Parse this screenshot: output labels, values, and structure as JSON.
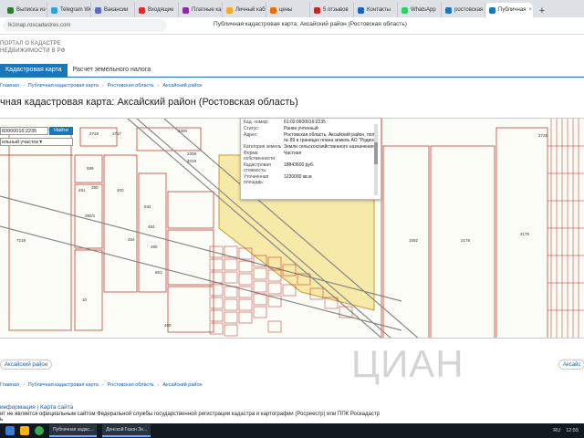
{
  "browser": {
    "tabs": [
      {
        "label": "Выписка из Е",
        "color": "#2e7d32",
        "active": false
      },
      {
        "label": "Telegram Web",
        "color": "#2aa3e0",
        "active": false
      },
      {
        "label": "Вакансии",
        "color": "#5c6bc0",
        "active": false
      },
      {
        "label": "Входящие",
        "color": "#d93025",
        "active": false
      },
      {
        "label": "Платные карт",
        "color": "#8e24aa",
        "active": false
      },
      {
        "label": "Личный каби",
        "color": "#f9a825",
        "active": false
      },
      {
        "label": "цены",
        "color": "#ef6c00",
        "active": false
      },
      {
        "label": "5 отзывов",
        "color": "#c62828",
        "active": false
      },
      {
        "label": "Контакты",
        "color": "#1565c0",
        "active": false
      },
      {
        "label": "WhatsApp",
        "color": "#25d366",
        "active": false
      },
      {
        "label": "ростовская",
        "color": "#1976b8",
        "active": false
      },
      {
        "label": "Публичная",
        "color": "#1976b8",
        "active": true
      }
    ],
    "url": "lk1map.roscadastres.com",
    "window_title": "Публичная кадастровая карта: Аксайский район (Ростовская область)"
  },
  "site": {
    "portal_line1": "ПОРТАЛ О КАДАСТРЕ",
    "portal_line2": "НЕДВИЖИМОСТИ В РФ",
    "nav": {
      "tab1": "Кадастровая карта",
      "tab2": "Расчет земельного налога"
    },
    "breadcrumbs_top": [
      "Главная",
      "Публичная кадастровая карта",
      "Ростовская область",
      "Аксайский район"
    ],
    "page_title": "чная кадастровая карта: Аксайский район (Ростовская область)"
  },
  "search": {
    "value": "60000016:2235",
    "button": "Найти",
    "select": "ельный участок"
  },
  "info": {
    "rows": [
      {
        "k": "Кад. номер:",
        "v": "61:02:0600016:2235"
      },
      {
        "k": "Статус:",
        "v": "Ранее учтенный"
      },
      {
        "k": "Адрес:",
        "v": "Ростовская область, Аксайский район, поле № 89 в границах плана земель АО \"Родина\""
      },
      {
        "k": "Категория земель:",
        "v": "Земли сельскохозяйственного назначения"
      },
      {
        "k": "Форма собственности:",
        "v": "Частная"
      },
      {
        "k": "Кадастровая стоимость:",
        "v": "18843600 руб."
      },
      {
        "k": "Уточненная площадь:",
        "v": "1230000 кв.м"
      }
    ]
  },
  "map_labels": [
    "2718",
    "2306",
    "2717",
    "599",
    "491",
    "390",
    "390/1",
    "7219",
    "10",
    "400",
    "842",
    "484",
    "464",
    "460",
    "861",
    "490",
    "1592",
    "2178",
    "2176",
    "2725",
    "2308",
    "4019"
  ],
  "below_map": {
    "left_pill": "Аксайский район",
    "right_pill": "Аксайс",
    "breadcrumbs": [
      "Главная",
      "Публичная кадастровая карта",
      "Ростовская область",
      "Аксайский район"
    ]
  },
  "watermark": "ЦИАН",
  "footer": {
    "links": "информация | Карта сайта",
    "note": "ит не является официальным сайтом Федеральной службы государственной регистрации кадастра и картографии (Росреестр) или ППК Роскадастр",
    "copyright": "ь"
  },
  "taskbar": {
    "app1": "Публичная кадас...",
    "app2": "Донской Газон Зе...",
    "lang": "RU",
    "time": "12:55"
  }
}
